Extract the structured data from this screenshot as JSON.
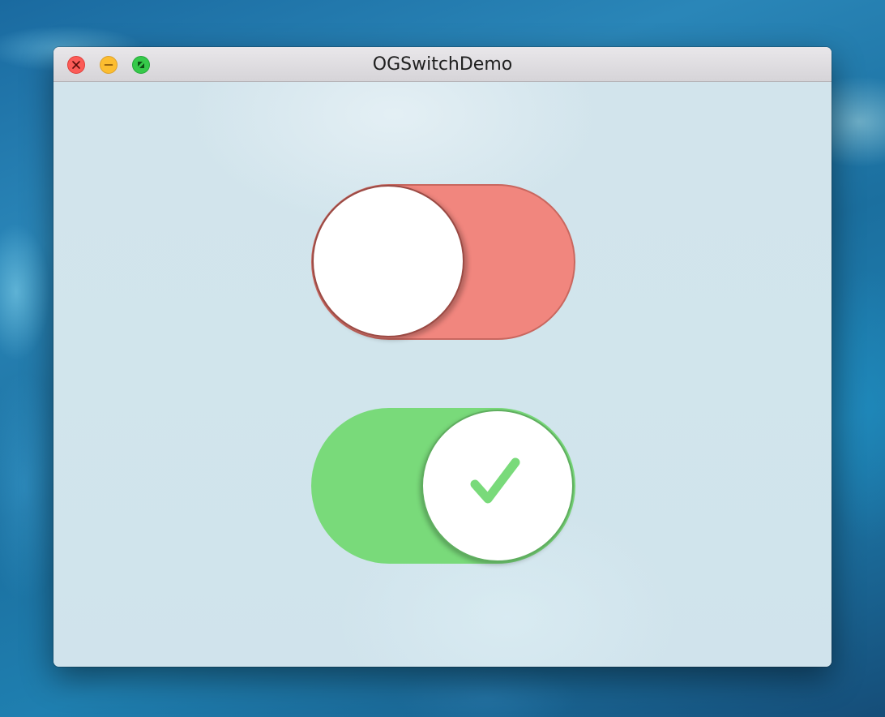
{
  "window": {
    "title": "OGSwitchDemo"
  },
  "traffic_lights": [
    {
      "name": "close",
      "icon": "close-icon",
      "color": "#fc5b57"
    },
    {
      "name": "minimize",
      "icon": "minimize-icon",
      "color": "#fcbd30"
    },
    {
      "name": "zoom",
      "icon": "fullscreen-icon",
      "color": "#36c94a"
    }
  ],
  "switches": [
    {
      "state": "off",
      "track_color": "#f1867e",
      "knob_color": "#ffffff",
      "icon": null
    },
    {
      "state": "on",
      "track_color": "#79da7a",
      "knob_color": "#ffffff",
      "icon": "checkmark-icon",
      "icon_color": "#79da7a"
    }
  ]
}
